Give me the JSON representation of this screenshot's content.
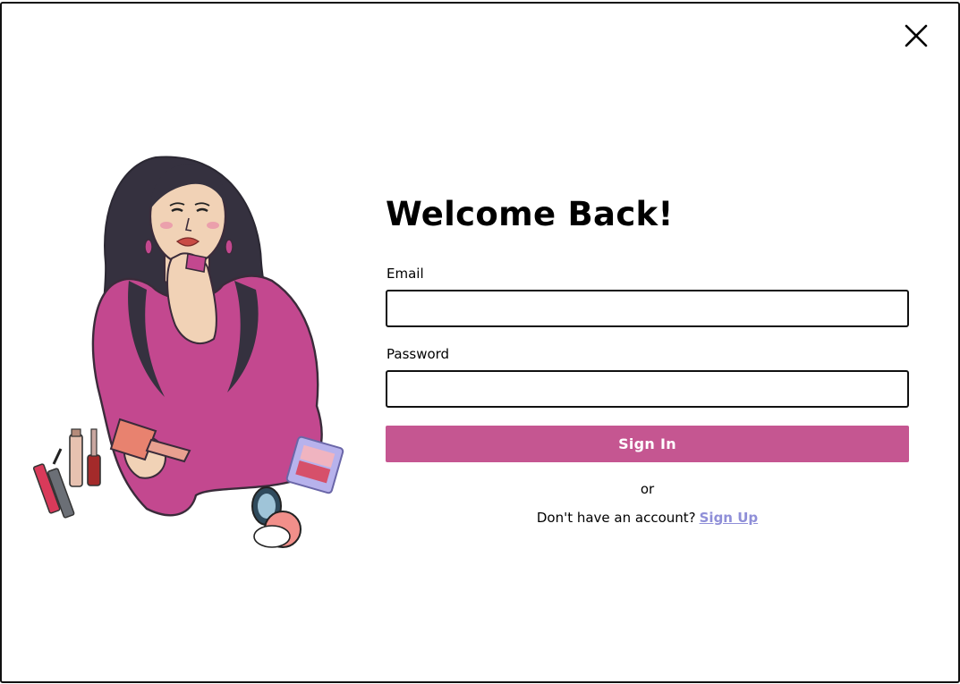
{
  "dialog": {
    "title": "Welcome Back!",
    "close_icon": "close-icon"
  },
  "form": {
    "email_label": "Email",
    "email_value": "",
    "password_label": "Password",
    "password_value": "",
    "submit_label": "Sign In",
    "divider_text": "or",
    "signup_prompt": "Don't have an account?",
    "signup_link": "Sign Up"
  },
  "colors": {
    "accent": "#c55691",
    "link": "#8f8fd8",
    "border": "#111111",
    "background": "#ffffff"
  },
  "illustration": {
    "icon": "woman-makeup-illustration"
  }
}
